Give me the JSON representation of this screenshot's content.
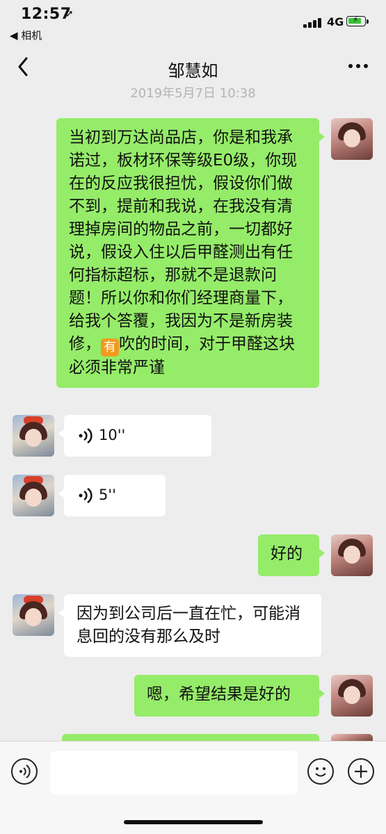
{
  "status": {
    "time": "12:57",
    "back_app": "◀ 相机",
    "network": "4G"
  },
  "nav": {
    "title": "邹慧如"
  },
  "timestamp": "2019年5月7日 10:38",
  "messages": [
    {
      "from": "self",
      "type": "text",
      "text_before_emoji": "当初到万达尚品店，你是和我承诺过，板材环保等级E0级，你现在的反应我很担忧，假设你们做不到，提前和我说，在我没有清理掉房间的物品之前，一切都好说，假设入住以后甲醛测出有任何指标超标，那就不是退款问题！所以你和你们经理商量下，给我个答覆，我因为不是新房装修，",
      "emoji": "有",
      "text_after_emoji": "吹的时间，对于甲醛这块必须非常严谨"
    },
    {
      "from": "other",
      "type": "voice",
      "duration": "10''"
    },
    {
      "from": "other",
      "type": "voice",
      "duration": "5''"
    },
    {
      "from": "self",
      "type": "text",
      "text": "好的"
    },
    {
      "from": "other",
      "type": "text",
      "text": "因为到公司后一直在忙，可能消息回的没有那么及时"
    },
    {
      "from": "self",
      "type": "text",
      "text": "嗯，希望结果是好的"
    }
  ],
  "icons": {
    "voice_toggle": "voice-icon",
    "emoji": "smiley-icon",
    "more": "plus-icon"
  },
  "colors": {
    "self_bubble": "#95ec69",
    "other_bubble": "#ffffff",
    "background": "#ededed"
  }
}
